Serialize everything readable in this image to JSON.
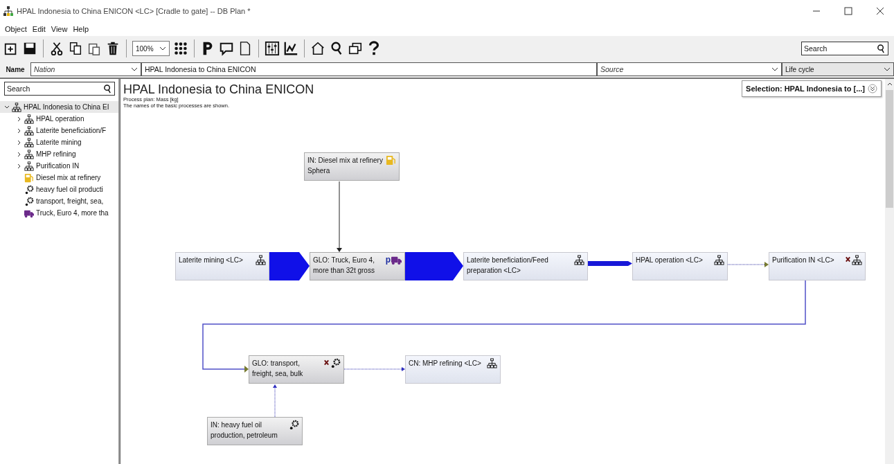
{
  "window": {
    "title": "HPAL Indonesia to China ENICON <LC> [Cradle to gate] -- DB Plan *"
  },
  "menu": [
    "Object",
    "Edit",
    "View",
    "Help"
  ],
  "toolbar": {
    "zoom": "100%",
    "search": {
      "placeholder": "Search"
    }
  },
  "name_row": {
    "label": "Name",
    "nation": {
      "placeholder": "Nation"
    },
    "name": "HPAL Indonesia to China ENICON",
    "source": {
      "placeholder": "Source"
    },
    "life_cycle": "Life cycle"
  },
  "sidebar": {
    "search": {
      "placeholder": "Search"
    },
    "tree": [
      {
        "label": "HPAL Indonesia to China EI",
        "kind": "plan",
        "expanded": true,
        "children": [
          {
            "label": "HPAL operation",
            "kind": "plan",
            "expanded": false
          },
          {
            "label": "Laterite beneficiation/F",
            "kind": "plan",
            "expanded": false
          },
          {
            "label": "Laterite mining",
            "kind": "plan",
            "expanded": false
          },
          {
            "label": "MHP refining",
            "kind": "plan",
            "expanded": false
          },
          {
            "label": "Purification IN",
            "kind": "plan",
            "expanded": false
          },
          {
            "label": "Diesel mix at refinery",
            "kind": "fuel"
          },
          {
            "label": "heavy fuel oil producti",
            "kind": "process"
          },
          {
            "label": "transport, freight, sea,",
            "kind": "process"
          },
          {
            "label": "Truck, Euro 4, more tha",
            "kind": "truck"
          }
        ]
      }
    ]
  },
  "diagram": {
    "title": "HPAL Indonesia to China ENICON",
    "subtitle": "Process plan: Mass [kg]",
    "note": "The names of the basic processes are shown.",
    "selection": "Selection: HPAL Indonesia to [...]",
    "nodes": [
      {
        "label": "IN: Diesel mix at refinery Sphera",
        "kind": "fuel",
        "x_mark": false
      },
      {
        "label": "Laterite mining <LC>",
        "kind": "plan",
        "x_mark": false
      },
      {
        "label": "GLO: Truck, Euro 4, more than 32t gross",
        "kind": "truck",
        "badge": "p",
        "x_mark": false
      },
      {
        "label": "Laterite beneficiation/Feed preparation <LC>",
        "kind": "plan",
        "x_mark": false
      },
      {
        "label": "HPAL operation <LC>",
        "kind": "plan",
        "x_mark": false
      },
      {
        "label": "Purification IN <LC>",
        "kind": "plan",
        "x_mark": true
      },
      {
        "label": "GLO: transport, freight, sea, bulk",
        "kind": "process",
        "x_mark": true
      },
      {
        "label": "CN: MHP refining <LC>",
        "kind": "plan",
        "x_mark": false
      },
      {
        "label": "IN: heavy fuel oil production, petroleum",
        "kind": "process",
        "x_mark": false
      }
    ]
  }
}
